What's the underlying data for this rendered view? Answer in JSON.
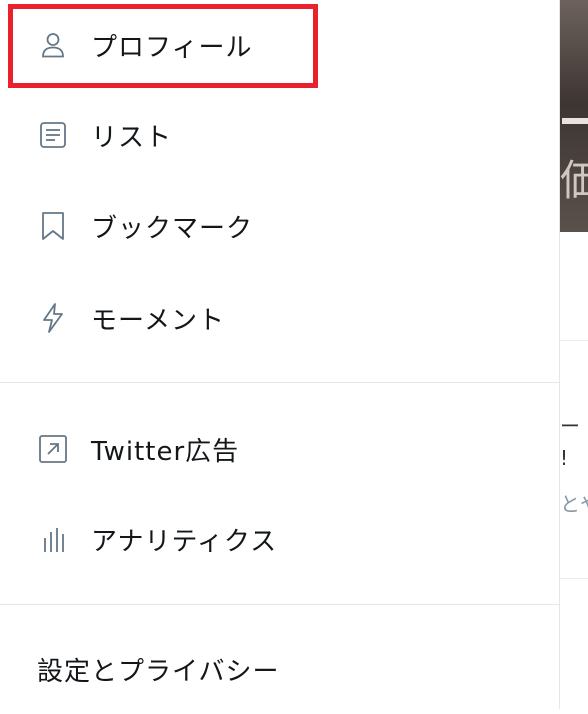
{
  "menu": {
    "items": [
      {
        "label": "プロフィール",
        "icon": "person-icon"
      },
      {
        "label": "リスト",
        "icon": "list-icon"
      },
      {
        "label": "ブックマーク",
        "icon": "bookmark-icon"
      },
      {
        "label": "モーメント",
        "icon": "lightning-icon"
      }
    ],
    "items2": [
      {
        "label": "Twitter広告",
        "icon": "external-link-icon"
      },
      {
        "label": "アナリティクス",
        "icon": "analytics-icon"
      }
    ],
    "settings_label": "設定とプライバシー"
  },
  "background": {
    "headline_char": "価",
    "text1": "ー",
    "text2": "!",
    "text3": "とや"
  },
  "colors": {
    "highlight": "#e8212c",
    "icon": "#657786",
    "text": "#14171a",
    "divider": "#e1e8ed"
  }
}
